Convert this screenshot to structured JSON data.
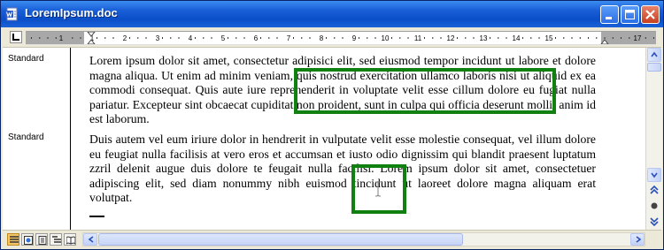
{
  "window": {
    "title": "LoremIpsum.doc",
    "icon": "word-document-icon",
    "controls": [
      "minimize-icon",
      "maximize-icon",
      "close-icon"
    ]
  },
  "ruler": {
    "tab_selector_label": "L",
    "numbers": [
      "1",
      "1",
      "2",
      "3",
      "4",
      "5",
      "6",
      "7",
      "8",
      "9",
      "10",
      "11",
      "12",
      "13",
      "14",
      "15",
      "17"
    ]
  },
  "style_area": {
    "labels": [
      "Standard",
      "Standard"
    ]
  },
  "document": {
    "paragraphs": [
      "Lorem ipsum dolor sit amet, consectetur adipisici elit, sed eiusmod tempor incidunt ut labore et dolore magna aliqua. Ut enim ad minim veniam, quis nostrud exercitation ullamco laboris nisi ut aliquid ex ea commodi consequat. Quis aute iure reprehenderit in voluptate velit esse cillum dolore eu fugiat nulla pariatur. Excepteur sint obcaecat cupiditat non proident, sunt in culpa qui officia deserunt mollit anim id est laborum.",
      "Duis autem vel eum iriure dolor in hendrerit in vulputate velit esse molestie consequat, vel illum dolore eu feugiat nulla facilisis at vero eros et accumsan et iusto odio dignissim qui blandit praesent luptatum zzril delenit augue duis dolore te feugait nulla facilisi. Lorem ipsum dolor sit amet, consectetuer adipiscing elit, sed diam nonummy nibh euismod tincidunt ut laoreet dolore magna aliquam erat volutpat."
    ],
    "highlight_color": "#108010"
  },
  "scrollbars": {
    "vertical_buttons": [
      "scroll-up-icon",
      "scroll-down-icon",
      "previous-page-icon",
      "select-browse-object-icon",
      "next-page-icon"
    ],
    "horizontal_buttons": [
      "scroll-left-icon",
      "scroll-right-icon"
    ]
  },
  "view_buttons": [
    "normal-view-icon",
    "web-layout-view-icon",
    "print-layout-view-icon",
    "outline-view-icon",
    "reading-layout-icon"
  ],
  "colors": {
    "titlebar": "#0a4fc8",
    "close_button": "#c8401f",
    "chrome": "#ece9d8"
  }
}
